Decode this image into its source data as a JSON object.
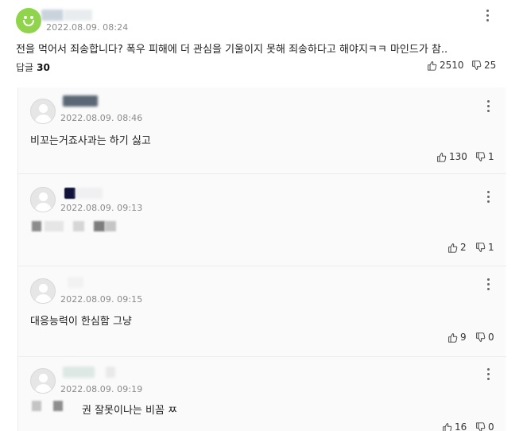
{
  "parent": {
    "date": "2022.08.09. 08:24",
    "text": "전을 먹어서 죄송합니다? 폭우 피해에 더 관심을 기울이지 못해 죄송하다고 해야지ㅋㅋ 마인드가 참..",
    "reply_label": "답글",
    "reply_count": "30",
    "likes": "2510",
    "dislikes": "25"
  },
  "replies": [
    {
      "date": "2022.08.09. 08:46",
      "text": "비꼬는거죠사과는 하기 싫고",
      "likes": "130",
      "dislikes": "1"
    },
    {
      "date": "2022.08.09. 09:13",
      "text": "",
      "likes": "2",
      "dislikes": "1"
    },
    {
      "date": "2022.08.09. 09:15",
      "text": "대응능력이 한심함 그냥",
      "likes": "9",
      "dislikes": "0"
    },
    {
      "date": "2022.08.09. 09:19",
      "text": "권 잘못이나는 비꼼 ㅉ",
      "likes": "16",
      "dislikes": "0"
    }
  ],
  "icons": {
    "like": "thumbs-up-icon",
    "dislike": "thumbs-down-icon",
    "more": "more-vertical-icon",
    "avatar_parent": "green-smiley-avatar",
    "avatar_default": "default-user-avatar"
  },
  "colors": {
    "avatar_green": "#8fd44a",
    "reply_bg": "#fafafa",
    "date": "#8a8a8a"
  }
}
